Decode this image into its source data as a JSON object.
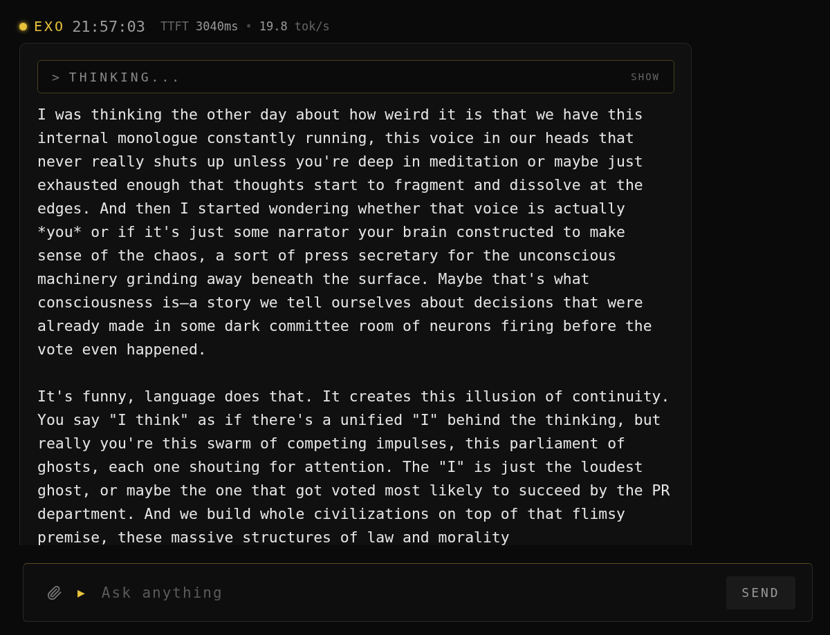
{
  "header": {
    "active": true,
    "brand": "EXO",
    "time": "21:57:03",
    "ttft_label": "TTFT",
    "ttft_value": "3040ms",
    "separator": "•",
    "rate_value": "19.8",
    "rate_unit": "tok/s"
  },
  "thinking": {
    "chevron": ">",
    "label": "THINKING...",
    "toggle": "SHOW",
    "expanded": false
  },
  "message": {
    "paragraphs": [
      "I was thinking the other day about how weird it is that we have this internal monologue constantly running, this voice in our heads that never really shuts up unless you're deep in meditation or maybe just exhausted enough that thoughts start to fragment and dissolve at the edges. And then I started wondering whether that voice is actually *you* or if it's just some narrator your brain constructed to make sense of the chaos, a sort of press secretary for the unconscious machinery grinding away beneath the surface. Maybe that's what consciousness is—a story we tell ourselves about decisions that were already made in some dark committee room of neurons firing before the vote even happened.",
      "It's funny, language does that. It creates this illusion of continuity. You say \"I think\" as if there's a unified \"I\" behind the thinking, but really you're this swarm of competing impulses, this parliament of ghosts, each one shouting for attention. The \"I\" is just the loudest ghost, or maybe the one that got voted most likely to succeed by the PR department. And we build whole civilizations on top of that flimsy premise, these massive structures of law and morality"
    ]
  },
  "composer": {
    "prompt_marker": "▶",
    "placeholder": "Ask anything",
    "send": "SEND"
  }
}
